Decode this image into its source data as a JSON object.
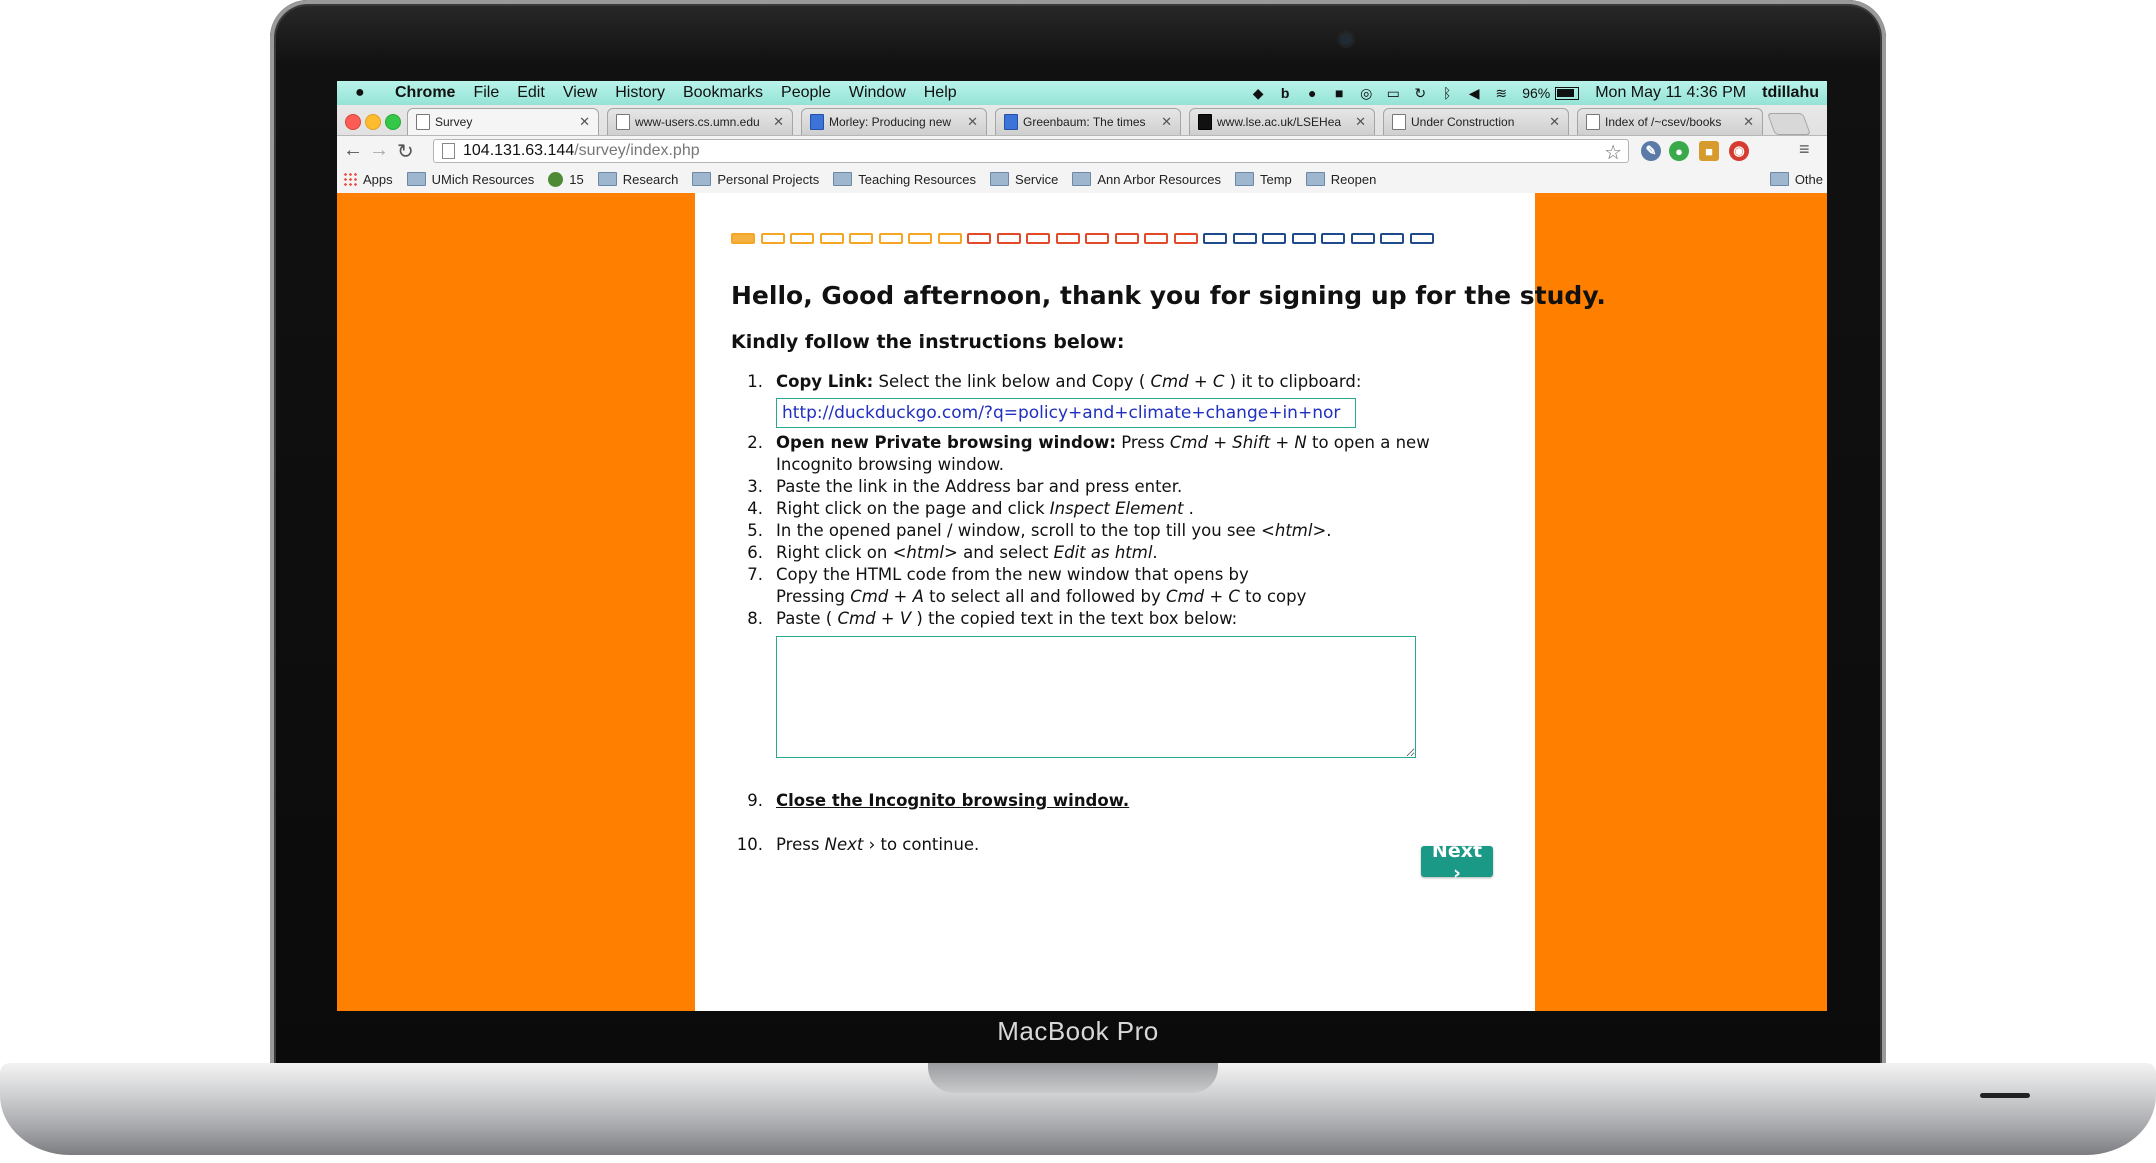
{
  "device": {
    "label": "MacBook Pro"
  },
  "menubar": {
    "app": "Chrome",
    "items": [
      "File",
      "Edit",
      "View",
      "History",
      "Bookmarks",
      "People",
      "Window",
      "Help"
    ],
    "battery": "96%",
    "clock": "Mon May 11  4:36 PM",
    "user": "tdillahu"
  },
  "tabs": [
    {
      "title": "Survey",
      "icon": "page-icon"
    },
    {
      "title": "www-users.cs.umn.edu",
      "icon": "page-icon"
    },
    {
      "title": "Morley: Producing new",
      "icon": "blue-icon"
    },
    {
      "title": "Greenbaum: The times",
      "icon": "blue-icon"
    },
    {
      "title": "www.lse.ac.uk/LSEHea",
      "icon": "lse-icon"
    },
    {
      "title": "Under Construction",
      "icon": "page-icon"
    },
    {
      "title": "Index of /~csev/books",
      "icon": "page-icon"
    }
  ],
  "address": {
    "host": "104.131.63.144",
    "path": "/survey/index.php"
  },
  "bookmarks": {
    "apps": "Apps",
    "items": [
      {
        "label": "UMich Resources",
        "type": "folder"
      },
      {
        "label": "15",
        "type": "globe"
      },
      {
        "label": "Research",
        "type": "folder"
      },
      {
        "label": "Personal Projects",
        "type": "folder"
      },
      {
        "label": "Teaching Resources",
        "type": "folder"
      },
      {
        "label": "Service",
        "type": "folder"
      },
      {
        "label": "Ann Arbor Resources",
        "type": "folder"
      },
      {
        "label": "Temp",
        "type": "folder"
      },
      {
        "label": "Reopen",
        "type": "folder"
      }
    ],
    "other": "Othe"
  },
  "survey": {
    "progress": {
      "total": 24,
      "completed": 1,
      "orange": 8,
      "red": 8,
      "blue": 8
    },
    "greeting": "Hello, Good afternoon, thank you for signing up for the study.",
    "instructions_heading": "Kindly follow the instructions below:",
    "link_value": "http://duckduckgo.com/?q=policy+and+climate+change+in+nor",
    "steps": {
      "s1_bold": "Copy Link:",
      "s1_a": " Select the link below and Copy ( ",
      "s1_key": "Cmd + C",
      "s1_b": " ) it to clipboard:",
      "s2_bold": "Open new Private browsing window:",
      "s2_a": " Press ",
      "s2_key": "Cmd + Shift + N",
      "s2_b": " to open a new Incognito browsing window.",
      "s3": "Paste the link in the Address bar and press enter.",
      "s4_a": "Right click on the page and click ",
      "s4_i": "Inspect Element",
      "s4_b": " .",
      "s5_a": "In the opened panel / window, scroll to the top till you see ",
      "s5_i": "<html>",
      "s5_b": ".",
      "s6_a": "Right click on ",
      "s6_i1": "<html>",
      "s6_b": " and select ",
      "s6_i2": "Edit as html",
      "s6_c": ".",
      "s7_a": "Copy the HTML code from the new window that opens by",
      "s7_b": "Pressing ",
      "s7_k1": "Cmd + A",
      "s7_c": " to select all and followed by ",
      "s7_k2": "Cmd + C",
      "s7_d": " to copy",
      "s8_a": "Paste ( ",
      "s8_key": "Cmd + V",
      "s8_b": " ) the copied text in the text box below:",
      "s9": "Close the Incognito browsing window.",
      "s10_a": "Press ",
      "s10_i": "Next",
      "s10_b": " › to continue."
    },
    "next_label": "Next ›"
  },
  "colors": {
    "page_bg": "#ff7f00",
    "accent": "#1a9a86",
    "link": "#1f2fbf"
  }
}
